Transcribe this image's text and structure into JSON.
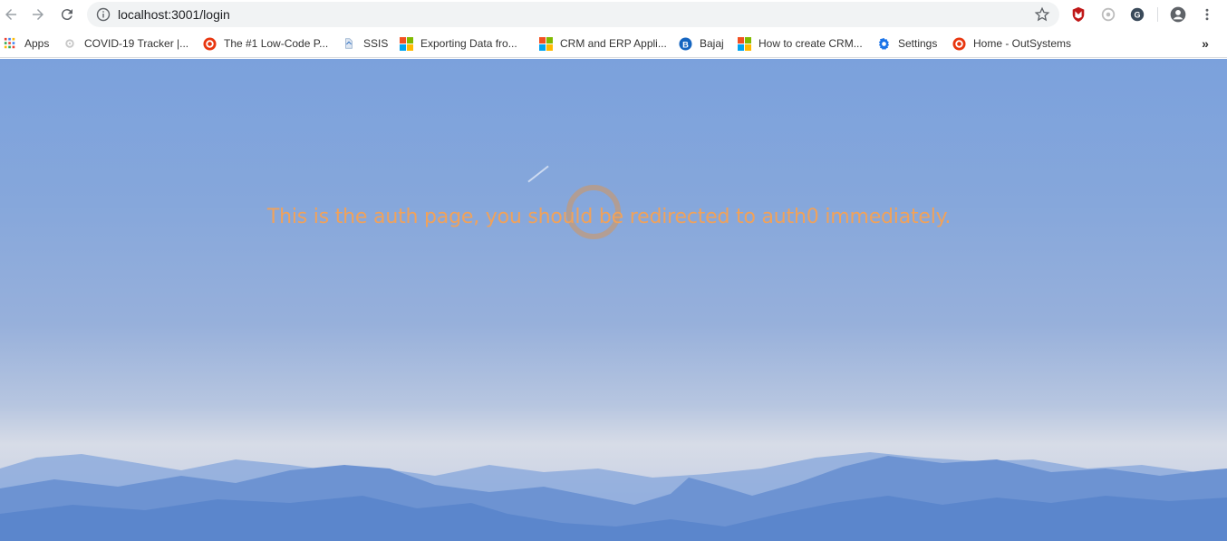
{
  "browser": {
    "url": "localhost:3001/login",
    "nav": {
      "back_icon": "arrow-left-icon",
      "forward_icon": "arrow-right-icon",
      "reload_icon": "reload-icon"
    },
    "extensions": [
      "mcafee-shield-icon",
      "extension-icon",
      "grammar-extension-icon"
    ],
    "profile_icon": "account-circle-icon",
    "menu_icon": "kebab-menu-icon"
  },
  "bookmarks": [
    {
      "label": "Apps",
      "icon": "apps-grid-icon"
    },
    {
      "label": "COVID-19 Tracker |...",
      "icon": "gear-gray-icon"
    },
    {
      "label": "The #1 Low-Code P...",
      "icon": "outsystems-icon"
    },
    {
      "label": "SSIS",
      "icon": "ssis-icon"
    },
    {
      "label": "Exporting Data fro...",
      "icon": "microsoft-icon"
    },
    {
      "label": "CRM and ERP Appli...",
      "icon": "microsoft-icon"
    },
    {
      "label": "Bajaj",
      "icon": "bajaj-icon"
    },
    {
      "label": "How to create CRM...",
      "icon": "microsoft-icon"
    },
    {
      "label": "Settings",
      "icon": "settings-gear-icon"
    },
    {
      "label": "Home - OutSystems",
      "icon": "outsystems-icon"
    }
  ],
  "bookmarks_more": "»",
  "page": {
    "message": "This is the auth page, you should be redirected to auth0 immediately."
  },
  "colors": {
    "message": "#f0a25b",
    "sky_top": "#7ba1dc",
    "mountains": "#5b86cc"
  }
}
